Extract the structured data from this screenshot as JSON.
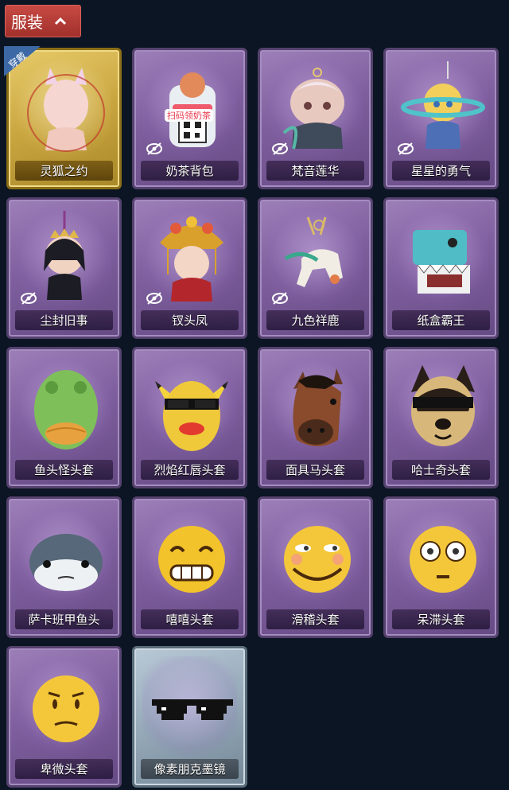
{
  "category": {
    "label": "服装",
    "chevron_icon": "chevron-up-icon"
  },
  "equipped_tag": "穿戴",
  "colors": {
    "accent_red": "#b33a35",
    "card_purple": "#8a6aa8",
    "equipped_gold": "#d4b24c",
    "special_silver": "#9fb1c0"
  },
  "items": [
    {
      "name": "灵狐之约",
      "hidden": false,
      "equipped": true,
      "art": "fox-outfit-figure"
    },
    {
      "name": "奶茶背包",
      "hidden": true,
      "equipped": false,
      "art": "milk-tea-backpack",
      "art_text": "扫码领奶茶"
    },
    {
      "name": "梵音莲华",
      "hidden": true,
      "equipped": false,
      "art": "lotus-pendant-figure"
    },
    {
      "name": "星星的勇气",
      "hidden": true,
      "equipped": false,
      "art": "star-courage-pendant"
    },
    {
      "name": "尘封旧事",
      "hidden": true,
      "equipped": false,
      "art": "dusty-past-pendant"
    },
    {
      "name": "钗头凤",
      "hidden": true,
      "equipped": false,
      "art": "phoenix-hairpin-pendant"
    },
    {
      "name": "九色祥鹿",
      "hidden": true,
      "equipped": false,
      "art": "nine-color-deer"
    },
    {
      "name": "纸盒霸王",
      "hidden": false,
      "equipped": false,
      "art": "cardboard-dino-head"
    },
    {
      "name": "鱼头怪头套",
      "hidden": false,
      "equipped": false,
      "art": "fish-head-mask"
    },
    {
      "name": "烈焰红唇头套",
      "hidden": false,
      "equipped": false,
      "art": "red-lips-mask"
    },
    {
      "name": "面具马头套",
      "hidden": false,
      "equipped": false,
      "art": "horse-head-mask"
    },
    {
      "name": "哈士奇头套",
      "hidden": false,
      "equipped": false,
      "art": "husky-head-mask"
    },
    {
      "name": "萨卡班甲鱼头",
      "hidden": false,
      "equipped": false,
      "art": "sacabambaspis-head"
    },
    {
      "name": "嘻嘻头套",
      "hidden": false,
      "equipped": false,
      "art": "grin-emoji-head"
    },
    {
      "name": "滑稽头套",
      "hidden": false,
      "equipped": false,
      "art": "funny-emoji-head"
    },
    {
      "name": "呆滞头套",
      "hidden": false,
      "equipped": false,
      "art": "dazed-emoji-head"
    },
    {
      "name": "卑微头套",
      "hidden": false,
      "equipped": false,
      "art": "humble-emoji-head"
    },
    {
      "name": "像素朋克墨镜",
      "hidden": false,
      "equipped": false,
      "special": true,
      "art": "pixel-sunglasses"
    }
  ]
}
